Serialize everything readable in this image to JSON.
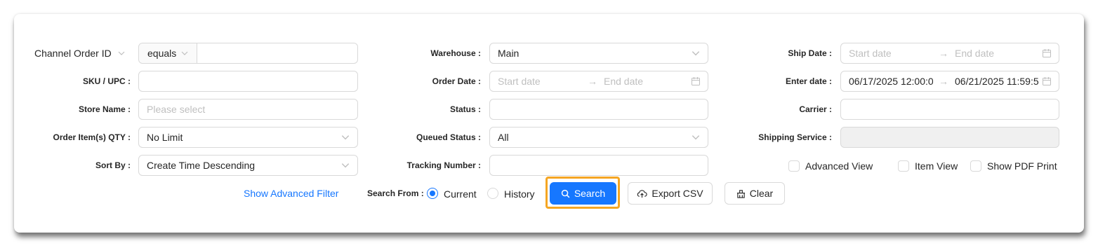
{
  "filters": {
    "channel_order_id": {
      "label": "Channel Order ID",
      "operator": "equals",
      "value": ""
    },
    "sku_upc": {
      "label": "SKU / UPC :",
      "value": ""
    },
    "store_name": {
      "label": "Store Name :",
      "placeholder": "Please select"
    },
    "order_item_qty": {
      "label": "Order Item(s) QTY :",
      "value": "No Limit"
    },
    "sort_by": {
      "label": "Sort By :",
      "value": "Create Time Descending"
    },
    "warehouse": {
      "label": "Warehouse :",
      "value": "Main"
    },
    "order_date": {
      "label": "Order Date :",
      "start_placeholder": "Start date",
      "end_placeholder": "End date"
    },
    "status": {
      "label": "Status :",
      "value": ""
    },
    "queued_status": {
      "label": "Queued Status :",
      "value": "All"
    },
    "tracking_number": {
      "label": "Tracking Number :",
      "value": ""
    },
    "ship_date": {
      "label": "Ship Date :",
      "start_placeholder": "Start date",
      "end_placeholder": "End date"
    },
    "enter_date": {
      "label": "Enter date :",
      "start": "06/17/2025 12:00:0",
      "end": "06/21/2025 11:59:5"
    },
    "carrier": {
      "label": "Carrier :",
      "value": ""
    },
    "shipping_service": {
      "label": "Shipping Service :",
      "value": ""
    }
  },
  "view_options": {
    "advanced_view": {
      "label": "Advanced View",
      "checked": false
    },
    "item_view": {
      "label": "Item View",
      "checked": false
    },
    "show_pdf_print": {
      "label": "Show PDF Print",
      "checked": false
    }
  },
  "actions": {
    "show_advanced_filter": "Show Advanced Filter",
    "search_from_label": "Search From :",
    "search_from_options": [
      "Current",
      "History"
    ],
    "search_from_selected": "Current",
    "search": "Search",
    "export_csv": "Export CSV",
    "clear": "Clear"
  },
  "colors": {
    "primary": "#1677ff",
    "highlight": "#f5a623",
    "border": "#d9d9d9",
    "placeholder": "#bfbfbf"
  },
  "icons": [
    "chevron-down-icon",
    "calendar-icon",
    "search-icon",
    "cloud-upload-icon",
    "clear-icon"
  ]
}
